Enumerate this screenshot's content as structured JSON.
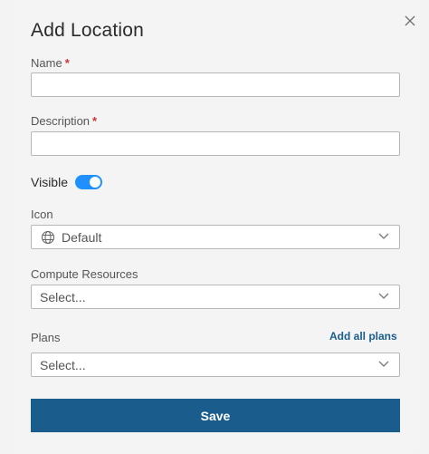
{
  "dialog": {
    "title": "Add Location",
    "close_icon": "close-icon"
  },
  "form": {
    "name": {
      "label": "Name",
      "required_mark": "*",
      "value": ""
    },
    "description": {
      "label": "Description",
      "required_mark": "*",
      "value": ""
    },
    "visible": {
      "label": "Visible",
      "enabled": true
    },
    "icon": {
      "label": "Icon",
      "selected": "Default",
      "icon_name": "globe-icon"
    },
    "compute_resources": {
      "label": "Compute Resources",
      "placeholder": "Select..."
    },
    "plans": {
      "label": "Plans",
      "placeholder": "Select...",
      "add_all_label": "Add all plans"
    }
  },
  "actions": {
    "save_label": "Save"
  },
  "colors": {
    "accent": "#1a5d8c",
    "toggle_on": "#1e90ff",
    "required": "#c9353a"
  }
}
